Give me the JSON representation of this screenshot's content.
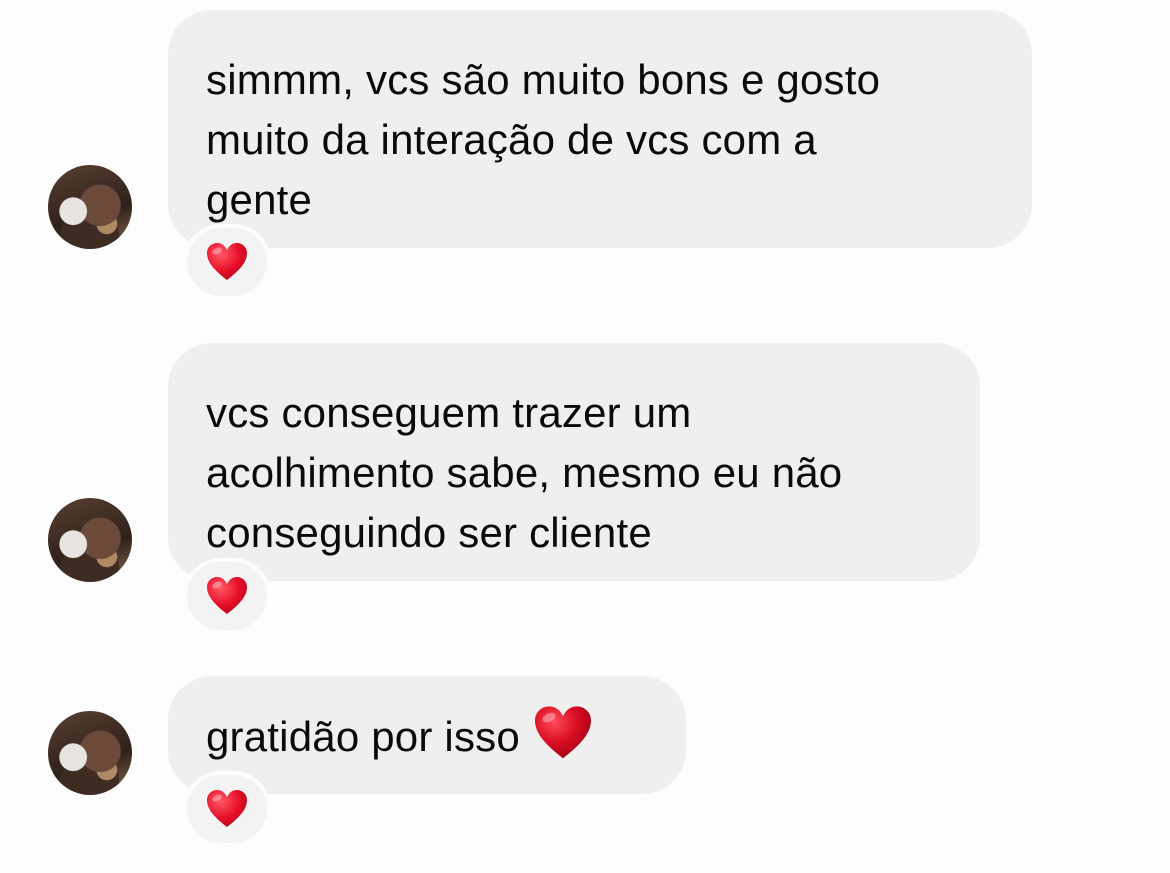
{
  "messages": [
    {
      "text": "simmm, vcs são muito bons e gosto\nmuito da interação de vcs com a\ngente",
      "reaction": "heart-icon"
    },
    {
      "text": "vcs conseguem trazer um\nacolhimento sabe, mesmo eu não\nconseguindo ser cliente",
      "reaction": "heart-icon"
    },
    {
      "text": "gratidão por isso",
      "inline_emoji": "heart-icon",
      "reaction": "heart-icon"
    }
  ],
  "colors": {
    "bubble": "#efefef",
    "background": "#fdfdfd",
    "heart": "#e8102a"
  }
}
